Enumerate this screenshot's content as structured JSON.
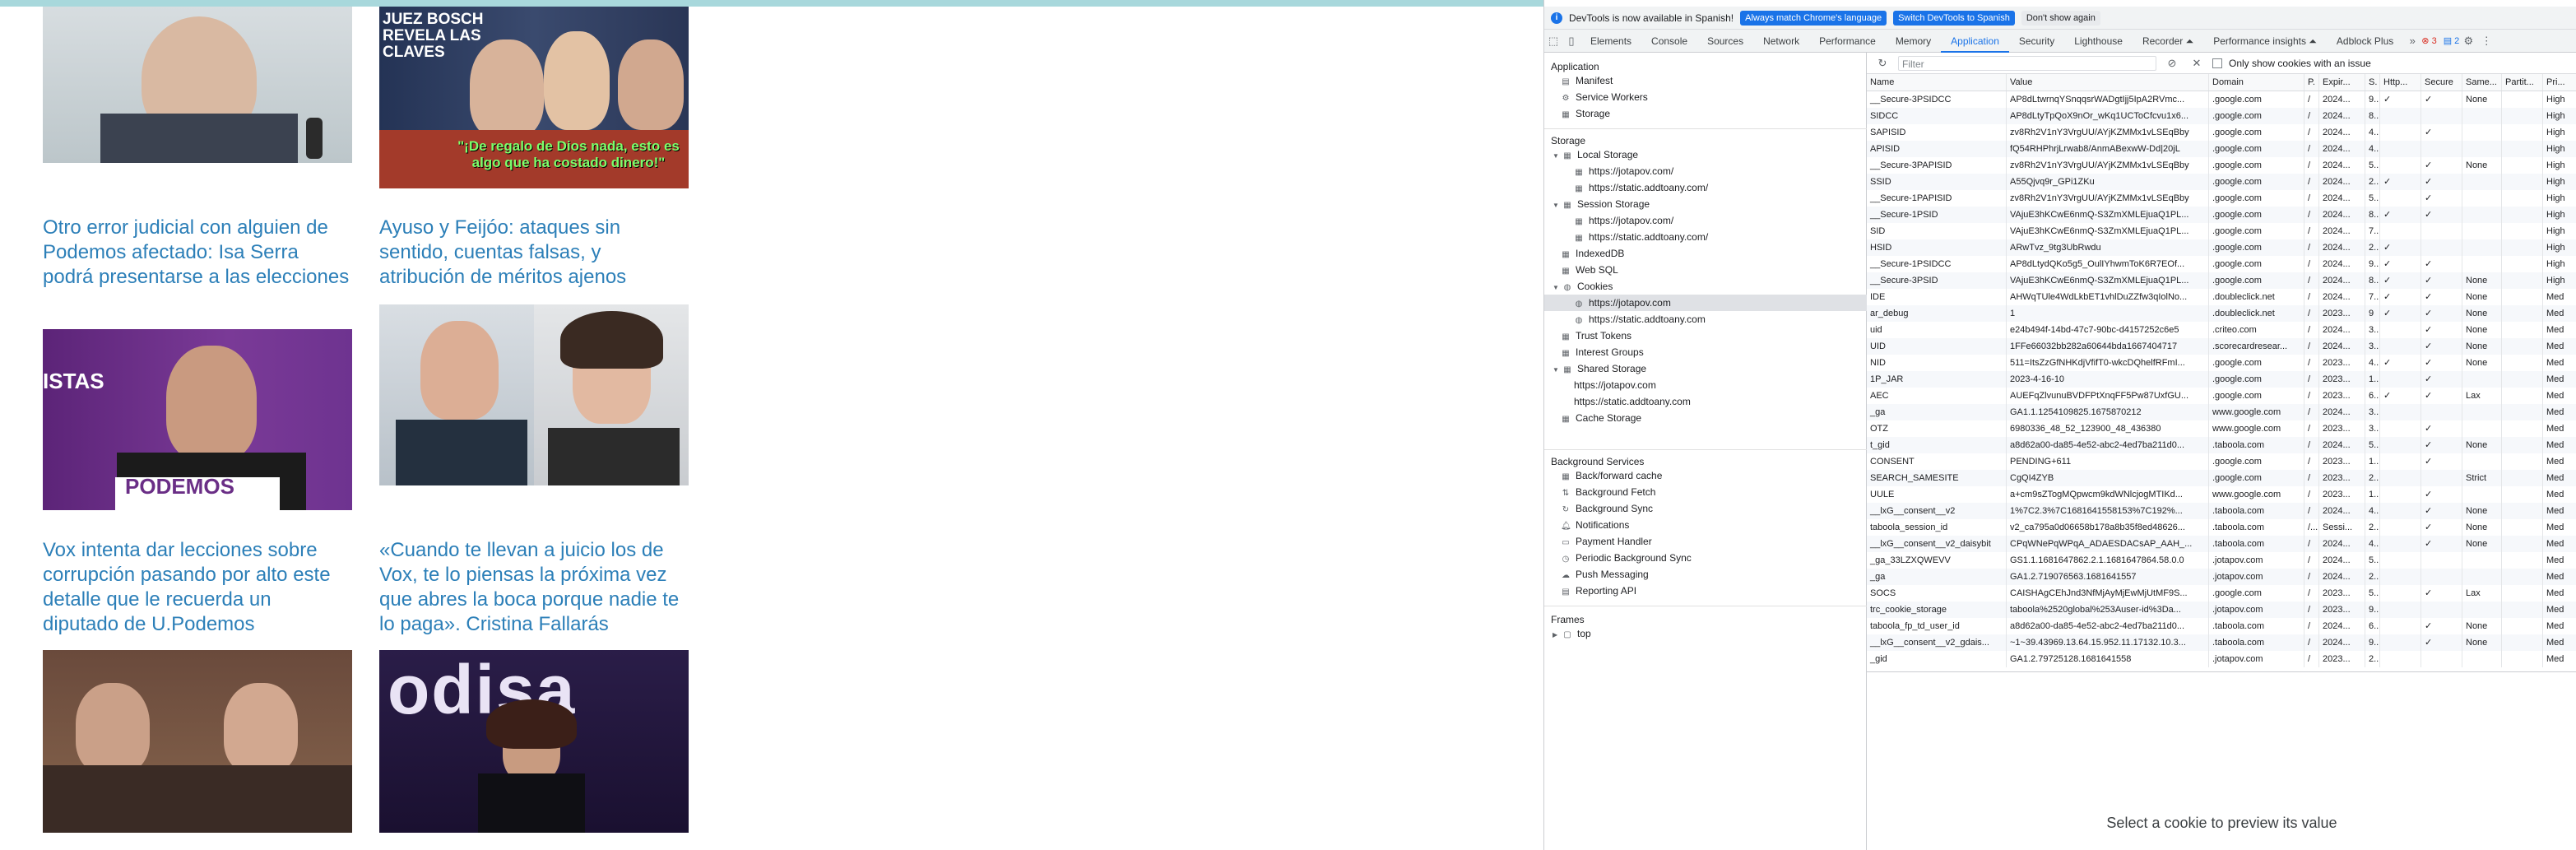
{
  "site": {
    "cards": [
      {
        "title": "",
        "image": "older man gesturing, microphone"
      },
      {
        "title": "",
        "image": "collage",
        "image_text": "JUEZ BOSCH REVELA LAS CLAVES",
        "image_caption": "\"¡De regalo de Dios nada, esto es algo que ha costado dinero!\""
      },
      {
        "title": "Otro error judicial con alguien de Podemos afectado: Isa Serra podrá presentarse a las elecciones",
        "image_text_1": "ISTAS",
        "image_text_2": "PODEMOS"
      },
      {
        "title": "Ayuso y Feijóo: ataques sin sentido, cuentas falsas, y atribución de méritos ajenos"
      },
      {
        "title": "Vox intenta dar lecciones sobre corrupción pasando por alto este detalle que le recuerda un diputado de U.Podemos"
      },
      {
        "title": "«Cuando te llevan a juicio los de Vox, te lo piensas la próxima vez que abres la boca porque nadie te lo paga». Cristina Fallarás",
        "image_text": "odisa"
      }
    ]
  },
  "devtools": {
    "infobar": {
      "text": "DevTools is now available in Spanish!",
      "btn_match": "Always match Chrome's language",
      "btn_switch": "Switch DevTools to Spanish",
      "btn_dismiss": "Don't show again"
    },
    "tabs": [
      "Elements",
      "Console",
      "Sources",
      "Network",
      "Performance",
      "Memory",
      "Application",
      "Security",
      "Lighthouse",
      "Recorder ⏶",
      "Performance insights ⏶",
      "Adblock Plus"
    ],
    "active_tab": "Application",
    "errors": "3",
    "messages": "2",
    "sidebar": {
      "application_label": "Application",
      "application_items": [
        "Manifest",
        "Service Workers",
        "Storage"
      ],
      "storage_label": "Storage",
      "local_storage": "Local Storage",
      "local_storage_items": [
        "https://jotapov.com/",
        "https://static.addtoany.com/"
      ],
      "session_storage": "Session Storage",
      "session_storage_items": [
        "https://jotapov.com/",
        "https://static.addtoany.com/"
      ],
      "indexeddb": "IndexedDB",
      "websql": "Web SQL",
      "cookies": "Cookies",
      "cookie_items": [
        "https://jotapov.com",
        "https://static.addtoany.com"
      ],
      "trust_tokens": "Trust Tokens",
      "interest_groups": "Interest Groups",
      "shared_storage": "Shared Storage",
      "shared_storage_items": [
        "https://jotapov.com",
        "https://static.addtoany.com"
      ],
      "cache_storage": "Cache Storage",
      "bg_label": "Background Services",
      "bg_items": [
        "Back/forward cache",
        "Background Fetch",
        "Background Sync",
        "Notifications",
        "Payment Handler",
        "Periodic Background Sync",
        "Push Messaging",
        "Reporting API"
      ],
      "frames_label": "Frames",
      "frames_top": "top"
    },
    "filter_placeholder": "Filter",
    "only_issue_label": "Only show cookies with an issue",
    "columns": [
      "Name",
      "Value",
      "Domain",
      "P.",
      "Expir...",
      "S.",
      "Http...",
      "Secure",
      "Same...",
      "Partit...",
      "Pri..."
    ],
    "rows": [
      [
        "__Secure-3PSIDCC",
        "AP8dLtwrnqYSnqqsrWADgtIjj5IpA2RVmc...",
        ".google.com",
        "/",
        "2024...",
        "9...",
        "✓",
        "✓",
        "None",
        "",
        "High"
      ],
      [
        "SIDCC",
        "AP8dLtyTpQoX9nOr_wKq1UCToCfcvu1x6...",
        ".google.com",
        "/",
        "2024...",
        "8...",
        "",
        "",
        "",
        "",
        "High"
      ],
      [
        "SAPISID",
        "zv8Rh2V1nY3VrgUU/AYjKZMMx1vLSEqBby",
        ".google.com",
        "/",
        "2024...",
        "4...",
        "",
        "✓",
        "",
        "",
        "High"
      ],
      [
        "APISID",
        "fQ54RHPhrjLrwab8/AnmABexwW-Dd|20jL",
        ".google.com",
        "/",
        "2024...",
        "4...",
        "",
        "",
        "",
        "",
        "High"
      ],
      [
        "__Secure-3PAPISID",
        "zv8Rh2V1nY3VrgUU/AYjKZMMx1vLSEqBby",
        ".google.com",
        "/",
        "2024...",
        "5...",
        "",
        "✓",
        "None",
        "",
        "High"
      ],
      [
        "SSID",
        "A55Qjvq9r_GPi1ZKu",
        ".google.com",
        "/",
        "2024...",
        "2...",
        "✓",
        "✓",
        "",
        "",
        "High"
      ],
      [
        "__Secure-1PAPISID",
        "zv8Rh2V1nY3VrgUU/AYjKZMMx1vLSEqBby",
        ".google.com",
        "/",
        "2024...",
        "5...",
        "",
        "✓",
        "",
        "",
        "High"
      ],
      [
        "__Secure-1PSID",
        "VAjuE3hKCwE6nmQ-S3ZmXMLEjuaQ1PL...",
        ".google.com",
        "/",
        "2024...",
        "8...",
        "✓",
        "✓",
        "",
        "",
        "High"
      ],
      [
        "SID",
        "VAjuE3hKCwE6nmQ-S3ZmXMLEjuaQ1PL...",
        ".google.com",
        "/",
        "2024...",
        "7...",
        "",
        "",
        "",
        "",
        "High"
      ],
      [
        "HSID",
        "ARwTvz_9tg3UbRwdu",
        ".google.com",
        "/",
        "2024...",
        "2...",
        "✓",
        "",
        "",
        "",
        "High"
      ],
      [
        "__Secure-1PSIDCC",
        "AP8dLtydQKo5g5_OulIYhwmToK6R7EOf...",
        ".google.com",
        "/",
        "2024...",
        "9...",
        "✓",
        "✓",
        "",
        "",
        "High"
      ],
      [
        "__Secure-3PSID",
        "VAjuE3hKCwE6nmQ-S3ZmXMLEjuaQ1PL...",
        ".google.com",
        "/",
        "2024...",
        "8...",
        "✓",
        "✓",
        "None",
        "",
        "High"
      ],
      [
        "IDE",
        "AHWqTUle4WdLkbET1vhlDuZZfw3qIolNo...",
        ".doubleclick.net",
        "/",
        "2024...",
        "7...",
        "✓",
        "✓",
        "None",
        "",
        "Med"
      ],
      [
        "ar_debug",
        "1",
        ".doubleclick.net",
        "/",
        "2023...",
        "9",
        "✓",
        "✓",
        "None",
        "",
        "Med"
      ],
      [
        "uid",
        "e24b494f-14bd-47c7-90bc-d4157252c6e5",
        ".criteo.com",
        "/",
        "2024...",
        "3...",
        "",
        "✓",
        "None",
        "",
        "Med"
      ],
      [
        "UID",
        "1FFe66032bb282a60644bda1667404717",
        ".scorecardresear...",
        "/",
        "2024...",
        "3...",
        "",
        "✓",
        "None",
        "",
        "Med"
      ],
      [
        "NID",
        "511=ItsZzGfNHKdjVfifT0-wkcDQhelfRFmI...",
        ".google.com",
        "/",
        "2023...",
        "4...",
        "✓",
        "✓",
        "None",
        "",
        "Med"
      ],
      [
        "1P_JAR",
        "2023-4-16-10",
        ".google.com",
        "/",
        "2023...",
        "1...",
        "",
        "✓",
        "",
        "",
        "Med"
      ],
      [
        "AEC",
        "AUEFqZlvunuBVDFPtXnqFF5Pw87UxfGU...",
        ".google.com",
        "/",
        "2023...",
        "6...",
        "✓",
        "✓",
        "Lax",
        "",
        "Med"
      ],
      [
        "_ga",
        "GA1.1.1254109825.1675870212",
        "www.google.com",
        "/",
        "2024...",
        "3...",
        "",
        "",
        "",
        "",
        "Med"
      ],
      [
        "OTZ",
        "6980336_48_52_123900_48_436380",
        "www.google.com",
        "/",
        "2023...",
        "3...",
        "",
        "✓",
        "",
        "",
        "Med"
      ],
      [
        "t_gid",
        "a8d62a00-da85-4e52-abc2-4ed7ba211d0...",
        ".taboola.com",
        "/",
        "2024...",
        "5...",
        "",
        "✓",
        "None",
        "",
        "Med"
      ],
      [
        "CONSENT",
        "PENDING+611",
        ".google.com",
        "/",
        "2023...",
        "1...",
        "",
        "✓",
        "",
        "",
        "Med"
      ],
      [
        "SEARCH_SAMESITE",
        "CgQI4ZYB",
        ".google.com",
        "/",
        "2023...",
        "2...",
        "",
        "",
        "Strict",
        "",
        "Med"
      ],
      [
        "UULE",
        "a+cm9sZTogMQpwcm9kdWNlcjogMTIKd...",
        "www.google.com",
        "/",
        "2023...",
        "1...",
        "",
        "✓",
        "",
        "",
        "Med"
      ],
      [
        "__lxG__consent__v2",
        "1%7C2.3%7C1681641558153%7C192%...",
        ".taboola.com",
        "/",
        "2024...",
        "4...",
        "",
        "✓",
        "None",
        "",
        "Med"
      ],
      [
        "taboola_session_id",
        "v2_ca795a0d06658b178a8b35f8ed48626...",
        ".taboola.com",
        "/...",
        "Sessi...",
        "2...",
        "",
        "✓",
        "None",
        "",
        "Med"
      ],
      [
        "__lxG__consent__v2_daisybit",
        "CPqWNePqWPqA_ADAESDACsAP_AAH_...",
        ".taboola.com",
        "/",
        "2024...",
        "4...",
        "",
        "✓",
        "None",
        "",
        "Med"
      ],
      [
        "_ga_33LZXQWEVV",
        "GS1.1.1681647862.2.1.1681647864.58.0.0",
        ".jotapov.com",
        "/",
        "2024...",
        "5...",
        "",
        "",
        "",
        "",
        "Med"
      ],
      [
        "_ga",
        "GA1.2.719076563.1681641557",
        ".jotapov.com",
        "/",
        "2024...",
        "2...",
        "",
        "",
        "",
        "",
        "Med"
      ],
      [
        "SOCS",
        "CAISHAgCEhJnd3NfMjAyMjEwMjUtMF9S...",
        ".google.com",
        "/",
        "2023...",
        "5...",
        "",
        "✓",
        "Lax",
        "",
        "Med"
      ],
      [
        "trc_cookie_storage",
        "taboola%2520global%253Auser-id%3Da...",
        ".jotapov.com",
        "/",
        "2023...",
        "9...",
        "",
        "",
        "",
        "",
        "Med"
      ],
      [
        "taboola_fp_td_user_id",
        "a8d62a00-da85-4e52-abc2-4ed7ba211d0...",
        ".taboola.com",
        "/",
        "2024...",
        "6...",
        "",
        "✓",
        "None",
        "",
        "Med"
      ],
      [
        "__lxG__consent__v2_gdais...",
        "~1~39.43969.13.64.15.952.11.17132.10.3...",
        ".taboola.com",
        "/",
        "2024...",
        "9...",
        "",
        "✓",
        "None",
        "",
        "Med"
      ],
      [
        "_gid",
        "GA1.2.79725128.1681641558",
        ".jotapov.com",
        "/",
        "2023...",
        "2...",
        "",
        "",
        "",
        "",
        "Med"
      ]
    ],
    "preview_text": "Select a cookie to preview its value"
  }
}
